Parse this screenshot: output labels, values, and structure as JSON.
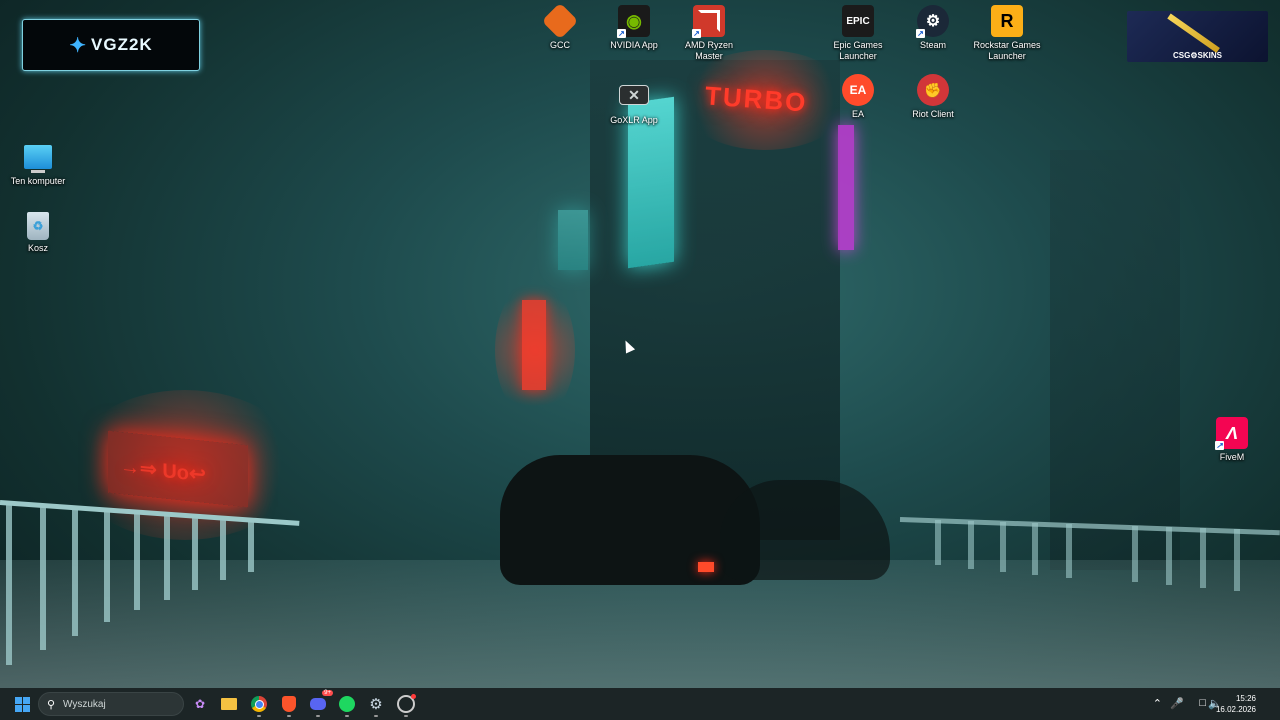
{
  "desktop": {
    "icons": {
      "gcc": {
        "label": "GCC"
      },
      "nvidia": {
        "label": "NVIDIA App"
      },
      "amd": {
        "label": "AMD Ryzen Master"
      },
      "epic": {
        "label": "Epic Games Launcher",
        "glyph": "EPIC"
      },
      "steam": {
        "label": "Steam"
      },
      "rockstar": {
        "label": "Rockstar Games Launcher",
        "glyph": "R"
      },
      "goxlr": {
        "label": "GoXLR App"
      },
      "ea": {
        "label": "EA",
        "glyph": "EA"
      },
      "riot": {
        "label": "Riot Client"
      },
      "pc": {
        "label": "Ten komputer"
      },
      "recycle": {
        "label": "Kosz"
      },
      "fivem": {
        "label": "FiveM"
      }
    },
    "widget_text": "VGZ2K",
    "csgo_text": "CSG⚙SKINS",
    "neon_sign_1": "TURBO",
    "neon_sign_2": "→⇒ Uo↩"
  },
  "taskbar": {
    "search_placeholder": "Wyszukaj",
    "discord_badge": "9+",
    "clock_time": "15:26",
    "clock_date": "16.02.2026"
  },
  "colors": {
    "accent": "#46a7f5",
    "taskbar": "#1c2526"
  }
}
